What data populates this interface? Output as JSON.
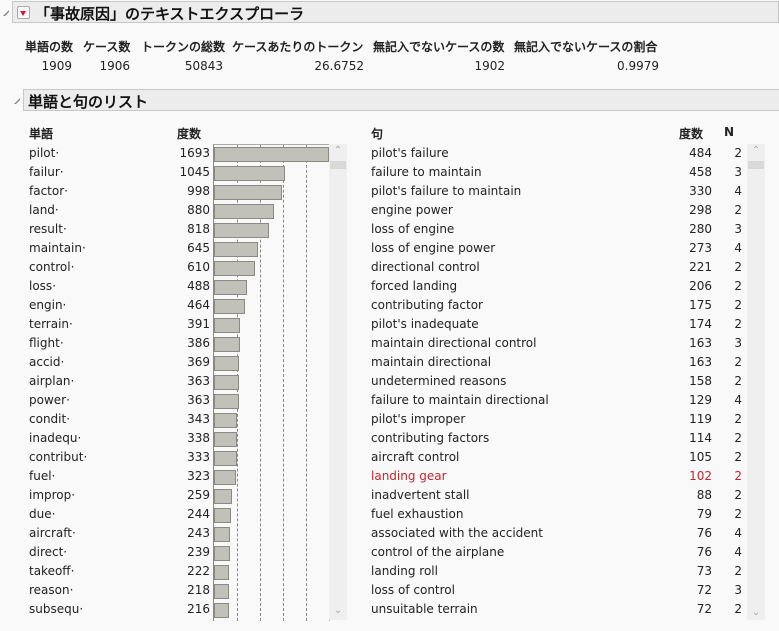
{
  "header": {
    "title": "「事故原因」のテキストエクスプローラ"
  },
  "summary": {
    "headers": [
      "単語の数",
      "ケース数",
      "トークンの総数",
      "ケースあたりのトークン",
      "無記入でないケースの数",
      "無記入でないケースの割合"
    ],
    "values": [
      "1909",
      "1906",
      "50843",
      "26.6752",
      "1902",
      "0.9979"
    ]
  },
  "section": {
    "title": "単語と句のリスト"
  },
  "words": {
    "col_word": "単語",
    "col_count": "度数",
    "axis_max": 1700,
    "items": [
      {
        "term": "pilot·",
        "count": 1693
      },
      {
        "term": "failur·",
        "count": 1045
      },
      {
        "term": "factor·",
        "count": 998
      },
      {
        "term": "land·",
        "count": 880
      },
      {
        "term": "result·",
        "count": 818
      },
      {
        "term": "maintain·",
        "count": 645
      },
      {
        "term": "control·",
        "count": 610
      },
      {
        "term": "loss·",
        "count": 488
      },
      {
        "term": "engin·",
        "count": 464
      },
      {
        "term": "terrain·",
        "count": 391
      },
      {
        "term": "flight·",
        "count": 386
      },
      {
        "term": "accid·",
        "count": 369
      },
      {
        "term": "airplan·",
        "count": 363
      },
      {
        "term": "power·",
        "count": 363
      },
      {
        "term": "condit·",
        "count": 343
      },
      {
        "term": "inadequ·",
        "count": 338
      },
      {
        "term": "contribut·",
        "count": 333
      },
      {
        "term": "fuel·",
        "count": 323
      },
      {
        "term": "improp·",
        "count": 259
      },
      {
        "term": "due·",
        "count": 244
      },
      {
        "term": "aircraft·",
        "count": 243
      },
      {
        "term": "direct·",
        "count": 239
      },
      {
        "term": "takeoff·",
        "count": 222
      },
      {
        "term": "reason·",
        "count": 218
      },
      {
        "term": "subsequ·",
        "count": 216
      }
    ]
  },
  "phrases": {
    "col_phrase": "句",
    "col_count": "度数",
    "col_n": "N",
    "highlight_color": "#c1272d",
    "items": [
      {
        "phrase": "pilot's failure",
        "count": "484",
        "n": "2"
      },
      {
        "phrase": "failure to maintain",
        "count": "458",
        "n": "3"
      },
      {
        "phrase": "pilot's failure to maintain",
        "count": "330",
        "n": "4"
      },
      {
        "phrase": "engine power",
        "count": "298",
        "n": "2"
      },
      {
        "phrase": "loss of engine",
        "count": "280",
        "n": "3"
      },
      {
        "phrase": "loss of engine power",
        "count": "273",
        "n": "4"
      },
      {
        "phrase": "directional control",
        "count": "221",
        "n": "2"
      },
      {
        "phrase": "forced landing",
        "count": "206",
        "n": "2"
      },
      {
        "phrase": "contributing factor",
        "count": "175",
        "n": "2"
      },
      {
        "phrase": "pilot's inadequate",
        "count": "174",
        "n": "2"
      },
      {
        "phrase": "maintain directional control",
        "count": "163",
        "n": "3"
      },
      {
        "phrase": "maintain directional",
        "count": "163",
        "n": "2"
      },
      {
        "phrase": "undetermined reasons",
        "count": "158",
        "n": "2"
      },
      {
        "phrase": "failure to maintain directional",
        "count": "129",
        "n": "4"
      },
      {
        "phrase": "pilot's improper",
        "count": "119",
        "n": "2"
      },
      {
        "phrase": "contributing factors",
        "count": "114",
        "n": "2"
      },
      {
        "phrase": "aircraft control",
        "count": "105",
        "n": "2"
      },
      {
        "phrase": "landing gear",
        "count": "102",
        "n": "2",
        "highlighted": true
      },
      {
        "phrase": "inadvertent stall",
        "count": "88",
        "n": "2"
      },
      {
        "phrase": "fuel exhaustion",
        "count": "79",
        "n": "2"
      },
      {
        "phrase": "associated with the accident",
        "count": "76",
        "n": "4"
      },
      {
        "phrase": "control of the airplane",
        "count": "76",
        "n": "4"
      },
      {
        "phrase": "landing roll",
        "count": "73",
        "n": "2"
      },
      {
        "phrase": "loss of control",
        "count": "72",
        "n": "3"
      },
      {
        "phrase": "unsuitable terrain",
        "count": "72",
        "n": "2"
      }
    ]
  },
  "icons": {
    "scroll_up": "⌃",
    "scroll_down": "⌄"
  }
}
